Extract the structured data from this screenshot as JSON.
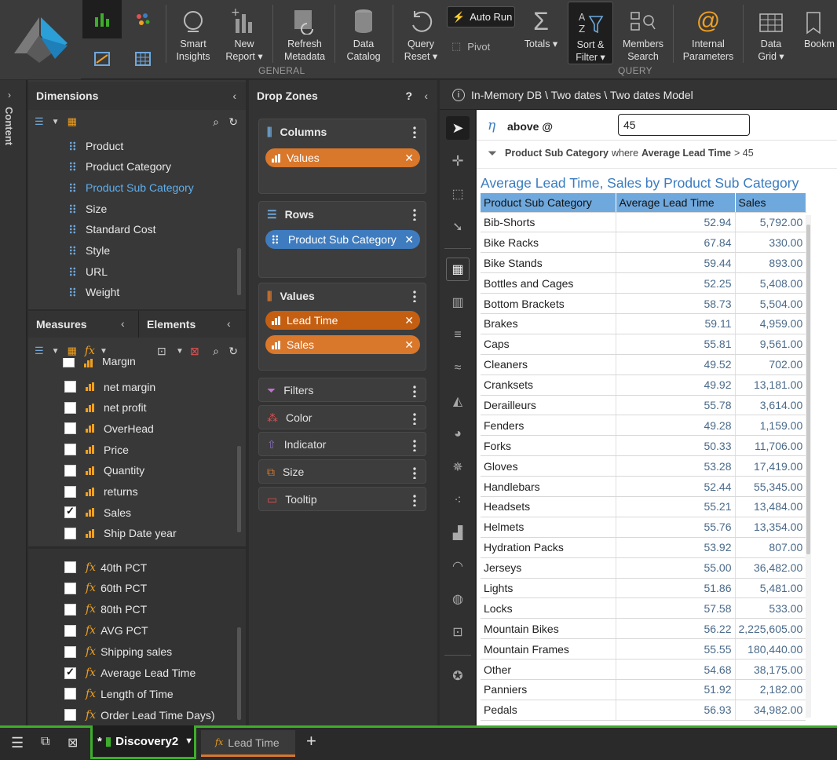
{
  "ribbon": {
    "buttons": [
      {
        "label1": "Smart",
        "label2": "Insights"
      },
      {
        "label1": "New",
        "label2": "Report ▾"
      },
      {
        "label1": "Refresh",
        "label2": "Metadata"
      },
      {
        "label1": "Data",
        "label2": "Catalog"
      },
      {
        "label1": "Query",
        "label2": "Reset ▾"
      },
      {
        "label1": "Totals ▾",
        "label2": ""
      },
      {
        "label1": "Sort &",
        "label2": "Filter ▾"
      },
      {
        "label1": "Members",
        "label2": "Search"
      },
      {
        "label1": "Internal",
        "label2": "Parameters"
      },
      {
        "label1": "Data",
        "label2": "Grid ▾"
      },
      {
        "label1": "Bookm",
        "label2": ""
      }
    ],
    "auto_run": "Auto Run",
    "pivot": "Pivot",
    "group_general": "GENERAL",
    "group_query": "QUERY"
  },
  "content_tab": "Content",
  "dimensions": {
    "title": "Dimensions",
    "items": [
      "Product",
      "Product Category",
      "Product Sub Category",
      "Size",
      "Standard Cost",
      "Style",
      "URL",
      "Weight"
    ],
    "selected": "Product Sub Category"
  },
  "measures": {
    "tab_measures": "Measures",
    "tab_elements": "Elements",
    "partial_item": "Margin",
    "items": [
      {
        "label": "net margin",
        "checked": false
      },
      {
        "label": "net profit",
        "checked": false
      },
      {
        "label": "OverHead",
        "checked": false
      },
      {
        "label": "Price",
        "checked": false
      },
      {
        "label": "Quantity",
        "checked": false
      },
      {
        "label": "returns",
        "checked": false
      },
      {
        "label": "Sales",
        "checked": true
      },
      {
        "label": "Ship Date year",
        "checked": false
      }
    ],
    "calc_items": [
      {
        "label": "40th PCT",
        "checked": false
      },
      {
        "label": "60th PCT",
        "checked": false
      },
      {
        "label": "80th PCT",
        "checked": false
      },
      {
        "label": "AVG PCT",
        "checked": false
      },
      {
        "label": "Shipping sales",
        "checked": false
      },
      {
        "label": "Average Lead Time",
        "checked": true
      },
      {
        "label": "Length of Time",
        "checked": false
      },
      {
        "label": "Order Lead Time Days)",
        "checked": false
      }
    ],
    "fx_symbol": "fx"
  },
  "dropzones": {
    "title": "Drop Zones",
    "help": "?",
    "columns": {
      "label": "Columns",
      "pills": [
        "Values"
      ]
    },
    "rows": {
      "label": "Rows",
      "pills": [
        "Product Sub Category"
      ]
    },
    "values": {
      "label": "Values",
      "pills": [
        "Lead Time",
        "Sales"
      ]
    },
    "filters": "Filters",
    "color": "Color",
    "indicator": "Indicator",
    "size": "Size",
    "tooltip": "Tooltip"
  },
  "breadcrumb": "In-Memory DB \\ Two dates \\ Two dates Model",
  "filter_bar": {
    "param_label": "above @",
    "param_value": "45",
    "field": "Product Sub Category",
    "where": "where",
    "measure": "Average Lead Time",
    "condition": "> 45"
  },
  "report": {
    "title": "Average Lead Time, Sales by Product Sub Category",
    "headers": [
      "Product Sub Category",
      "Average Lead Time",
      "Sales"
    ],
    "rows": [
      [
        "Bib-Shorts",
        "52.94",
        "5,792.00"
      ],
      [
        "Bike Racks",
        "67.84",
        "330.00"
      ],
      [
        "Bike Stands",
        "59.44",
        "893.00"
      ],
      [
        "Bottles and Cages",
        "52.25",
        "5,408.00"
      ],
      [
        "Bottom Brackets",
        "58.73",
        "5,504.00"
      ],
      [
        "Brakes",
        "59.11",
        "4,959.00"
      ],
      [
        "Caps",
        "55.81",
        "9,561.00"
      ],
      [
        "Cleaners",
        "49.52",
        "702.00"
      ],
      [
        "Cranksets",
        "49.92",
        "13,181.00"
      ],
      [
        "Derailleurs",
        "55.78",
        "3,614.00"
      ],
      [
        "Fenders",
        "49.28",
        "1,159.00"
      ],
      [
        "Forks",
        "50.33",
        "11,706.00"
      ],
      [
        "Gloves",
        "53.28",
        "17,419.00"
      ],
      [
        "Handlebars",
        "52.44",
        "55,345.00"
      ],
      [
        "Headsets",
        "55.21",
        "13,484.00"
      ],
      [
        "Helmets",
        "55.76",
        "13,354.00"
      ],
      [
        "Hydration Packs",
        "53.92",
        "807.00"
      ],
      [
        "Jerseys",
        "55.00",
        "36,482.00"
      ],
      [
        "Lights",
        "51.86",
        "5,481.00"
      ],
      [
        "Locks",
        "57.58",
        "533.00"
      ],
      [
        "Mountain Bikes",
        "56.22",
        "2,225,605.00"
      ],
      [
        "Mountain Frames",
        "55.55",
        "180,440.00"
      ],
      [
        "Other",
        "54.68",
        "38,175.00"
      ],
      [
        "Panniers",
        "51.92",
        "2,182.00"
      ],
      [
        "Pedals",
        "56.93",
        "34,982.00"
      ]
    ]
  },
  "bottom": {
    "tab_active": "Discovery2",
    "tab_active_prefix": "*",
    "tab_other": "Lead Time",
    "add": "+"
  },
  "colors": {
    "accent_green": "#3dae2b",
    "orange": "#d9772b",
    "blue": "#3f7cbf",
    "header_blue": "#6fa8dc",
    "title_blue": "#3a7cc0"
  }
}
